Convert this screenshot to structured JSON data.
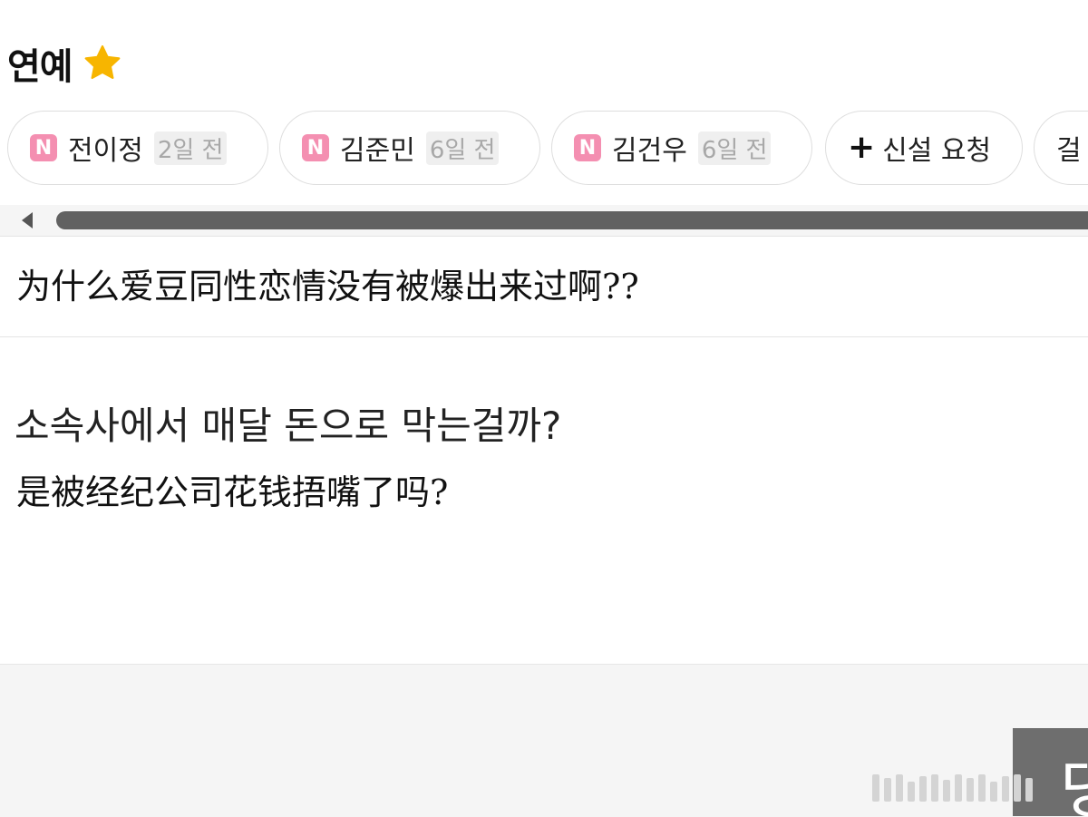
{
  "header": {
    "title": "연예",
    "icon": "star-icon"
  },
  "chips": [
    {
      "badge": "N",
      "name": "전이정",
      "time": "2일 전"
    },
    {
      "badge": "N",
      "name": "김준민",
      "time": "6일 전"
    },
    {
      "badge": "N",
      "name": "김건우",
      "time": "6일 전"
    },
    {
      "icon": "plus-icon",
      "label": "신설 요청"
    },
    {
      "label": "걸"
    }
  ],
  "post": {
    "title": "为什么爱豆同性恋情没有被爆出来过啊??",
    "body_korean": "소속사에서 매달 돈으로 막는걸까?",
    "body_chinese": "是被经纪公司花钱捂嘴了吗?"
  },
  "side_button": {
    "label": "댕"
  },
  "colors": {
    "badge": "#f48fb1",
    "star": "#f7b500",
    "scroll_thumb": "#616161"
  }
}
